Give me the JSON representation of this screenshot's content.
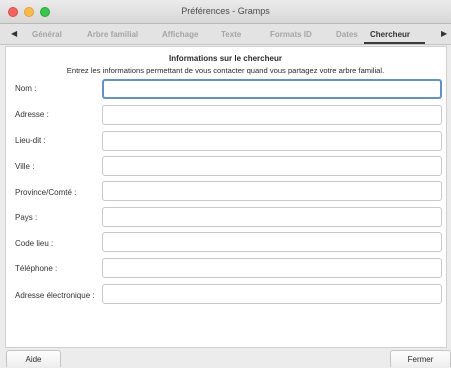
{
  "window": {
    "title": "Préférences - Gramps"
  },
  "tabs": [
    {
      "label": "Général",
      "active": false
    },
    {
      "label": "Arbre familial",
      "active": false
    },
    {
      "label": "Affichage",
      "active": false
    },
    {
      "label": "Texte",
      "active": false
    },
    {
      "label": "Formats ID",
      "active": false
    },
    {
      "label": "Dates",
      "active": false
    },
    {
      "label": "Chercheur",
      "active": true
    }
  ],
  "icons": {
    "tab_prev": "chevron-left-icon",
    "tab_next": "chevron-right-icon"
  },
  "researcher": {
    "heading": "Informations sur le chercheur",
    "description": "Entrez les informations permettant de vous contacter quand vous partagez votre arbre familial.",
    "fields": [
      {
        "label": "Nom :",
        "value": "",
        "placeholder": ""
      },
      {
        "label": "Adresse :",
        "value": "",
        "placeholder": ""
      },
      {
        "label": "Lieu-dit :",
        "value": "",
        "placeholder": ""
      },
      {
        "label": "Ville :",
        "value": "",
        "placeholder": ""
      },
      {
        "label": "Province/Comté :",
        "value": "",
        "placeholder": ""
      },
      {
        "label": "Pays :",
        "value": "",
        "placeholder": ""
      },
      {
        "label": "Code lieu :",
        "value": "",
        "placeholder": ""
      },
      {
        "label": "Téléphone :",
        "value": "",
        "placeholder": ""
      },
      {
        "label": "Adresse électronique :",
        "value": "",
        "placeholder": ""
      }
    ]
  },
  "buttons": {
    "help": "Aide",
    "close": "Fermer"
  },
  "colors": {
    "focus_ring": "#5f8fd7",
    "close_light": "#fc605c",
    "minimize_light": "#fdbc40",
    "zoom_light": "#34c84a"
  }
}
